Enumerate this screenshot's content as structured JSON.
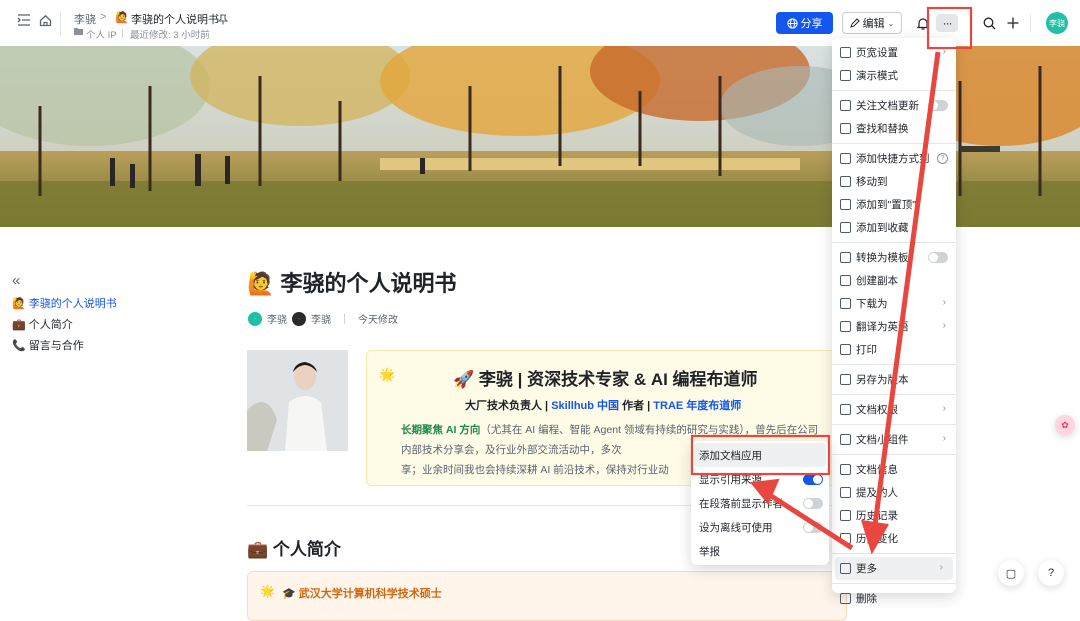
{
  "topbar": {
    "breadcrumb_parent": "李骁",
    "breadcrumb_sep": ">",
    "breadcrumb_emoji": "🙋",
    "breadcrumb_current": "李骁的个人说明书",
    "pin_icon": "pin-icon",
    "space_label": "个人 IP",
    "last_modified": "最近修改: 3 小时前",
    "share_label": "分享",
    "edit_label": "编辑",
    "more_label": "···",
    "avatar_text": "李骁"
  },
  "toc": {
    "collapse": "«",
    "items": [
      {
        "emoji": "🙋",
        "label": "李骁的个人说明书",
        "active": true
      },
      {
        "emoji": "💼",
        "label": "个人简介",
        "active": false
      },
      {
        "emoji": "📞",
        "label": "留言与合作",
        "active": false
      }
    ]
  },
  "doc": {
    "title_emoji": "🙋",
    "title": "李骁的个人说明书",
    "author1": "李骁",
    "author2": "李骁",
    "modified": "今天修改",
    "callout_icon": "🌟",
    "callout_heading": "🚀 李骁 | 资深技术专家 & AI 编程布道师",
    "callout_sub_a": "大厂技术负责人 | ",
    "callout_sub_b": "Skillhub 中国",
    "callout_sub_c": " 作者 | ",
    "callout_sub_d": "TRAE 年度布道师",
    "callout_p_bold": "长期聚焦 AI 方向",
    "callout_p_rest": "（尤其在 AI 编程、智能 Agent 领域有持续的研究与实践），曾先后在公司内部技术分享会，及行业外部交流活动中，多次",
    "callout_p_line3": "享；业余时间我也会持续深耕 AI 前沿技术，保持对行业动",
    "section_title": "💼 个人简介",
    "edu_icon": "🌟",
    "edu_line": "🎓 武汉大学计算机科学技术硕士"
  },
  "menu": {
    "items": [
      {
        "label": "页宽设置",
        "icon": "page-width-icon",
        "suffix": "chevron"
      },
      {
        "label": "演示模式",
        "icon": "present-icon",
        "suffix": ""
      },
      {
        "sep": true
      },
      {
        "label": "关注文档更新",
        "icon": "subscribe-icon",
        "suffix": "toggle"
      },
      {
        "label": "查找和替换",
        "icon": "find-icon",
        "suffix": ""
      },
      {
        "sep": true
      },
      {
        "label": "添加快捷方式到",
        "icon": "shortcut-icon",
        "suffix": "help"
      },
      {
        "label": "移动到",
        "icon": "move-icon",
        "suffix": ""
      },
      {
        "label": "添加到\"置顶\"",
        "icon": "pin-top-icon",
        "suffix": ""
      },
      {
        "label": "添加到收藏",
        "icon": "star-icon",
        "suffix": ""
      },
      {
        "sep": true
      },
      {
        "label": "转换为模板",
        "icon": "template-icon",
        "suffix": "toggle"
      },
      {
        "label": "创建副本",
        "icon": "copy-icon",
        "suffix": ""
      },
      {
        "label": "下载为",
        "icon": "download-icon",
        "suffix": "chevron"
      },
      {
        "label": "翻译为英语",
        "icon": "translate-icon",
        "suffix": "chevron"
      },
      {
        "label": "打印",
        "icon": "print-icon",
        "suffix": ""
      },
      {
        "sep": true
      },
      {
        "label": "另存为版本",
        "icon": "save-version-icon",
        "suffix": ""
      },
      {
        "sep": true
      },
      {
        "label": "文档权限",
        "icon": "permission-icon",
        "suffix": "chevron"
      },
      {
        "sep": true
      },
      {
        "label": "文档小组件",
        "icon": "widget-icon",
        "suffix": "chevron"
      },
      {
        "sep": true
      },
      {
        "label": "文档信息",
        "icon": "info-icon",
        "suffix": ""
      },
      {
        "label": "提及的人",
        "icon": "mention-icon",
        "suffix": ""
      },
      {
        "label": "历史记录",
        "icon": "history-icon",
        "suffix": ""
      },
      {
        "label": "历史变化",
        "icon": "history-change-icon",
        "suffix": ""
      },
      {
        "sep": true
      },
      {
        "label": "更多",
        "icon": "more-dots-icon",
        "suffix": "chevron",
        "highlight": true
      },
      {
        "sep": true
      },
      {
        "label": "删除",
        "icon": "trash-icon",
        "suffix": ""
      }
    ]
  },
  "submenu": {
    "items": [
      {
        "label": "添加文档应用",
        "toggle": null,
        "highlight": true
      },
      {
        "label": "显示引用来源",
        "toggle": true
      },
      {
        "label": "在段落前显示作者",
        "toggle": false
      },
      {
        "label": "设为离线可使用",
        "toggle": false
      },
      {
        "label": "举报",
        "toggle": null
      }
    ]
  },
  "colors": {
    "primary": "#1456f0",
    "annotation_red": "#e8473f",
    "avatar_green": "#1fc0a6"
  },
  "float_buttons": {
    "doc_icon": "▢",
    "help_icon": "?"
  }
}
